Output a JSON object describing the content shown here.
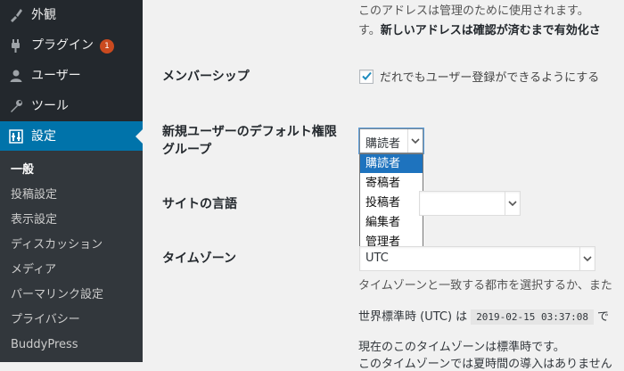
{
  "sidebar": {
    "menu": [
      {
        "label": "外観",
        "icon": "paintbrush-icon"
      },
      {
        "label": "プラグイン",
        "icon": "plugin-icon",
        "badge": "1"
      },
      {
        "label": "ユーザー",
        "icon": "user-icon"
      },
      {
        "label": "ツール",
        "icon": "wrench-icon"
      },
      {
        "label": "設定",
        "icon": "settings-sliders-icon",
        "current": true
      }
    ],
    "submenu": [
      {
        "label": "一般",
        "current": true
      },
      {
        "label": "投稿設定"
      },
      {
        "label": "表示設定"
      },
      {
        "label": "ディスカッション"
      },
      {
        "label": "メディア"
      },
      {
        "label": "パーマリンク設定"
      },
      {
        "label": "プライバシー"
      },
      {
        "label": "BuddyPress"
      }
    ]
  },
  "main": {
    "email_desc_line1": "このアドレスは管理のために使用されます。",
    "email_desc_line2_prefix": "す。",
    "email_desc_line2_bold": "新しいアドレスは確認が済むまで有効化さ",
    "membership": {
      "label": "メンバーシップ",
      "checkbox_label": "だれでもユーザー登録ができるようにする",
      "checked": true
    },
    "default_role": {
      "label_line1": "新規ユーザーのデフォルト権限",
      "label_line2": "グループ",
      "selected": "購読者",
      "options": [
        "購読者",
        "寄稿者",
        "投稿者",
        "編集者",
        "管理者"
      ],
      "highlighted_index": 0
    },
    "site_language": {
      "label": "サイトの言語",
      "value": ""
    },
    "timezone": {
      "label": "タイムゾーン",
      "value": "UTC",
      "hint": "タイムゾーンと一致する都市を選択するか、また",
      "utc_prefix": "世界標準時 (UTC) は",
      "utc_time": "2019-02-15 03:37:08",
      "utc_suffix": "で",
      "dst_note": "現在のこのタイムゾーンは標準時です。",
      "dst_note2": "このタイムゾーンでは夏時間の導入はありません"
    }
  },
  "colors": {
    "sidebar_bg": "#23282d",
    "submenu_bg": "#32373c",
    "current_menu_bg": "#0073aa",
    "badge": "#ca4a1f",
    "option_highlight": "#1e73be",
    "checkbox_check": "#1e8cbe"
  }
}
